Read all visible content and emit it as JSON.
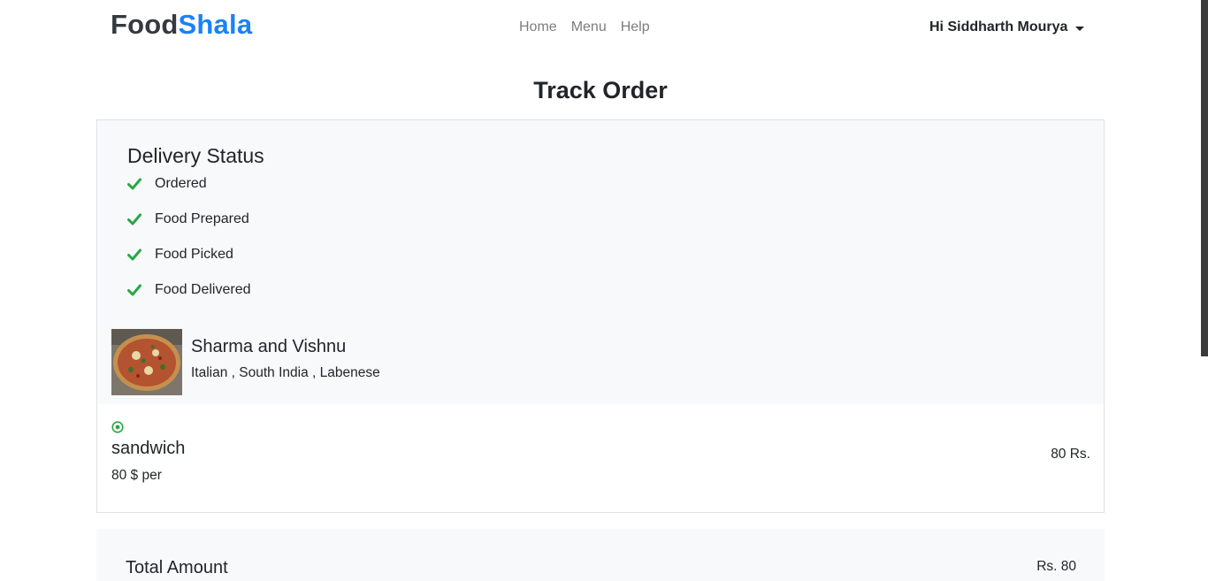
{
  "brand": {
    "part1": "Food",
    "part2": "Shala"
  },
  "nav": {
    "links": [
      "Home",
      "Menu",
      "Help"
    ]
  },
  "user": {
    "greeting": "Hi Siddharth Mourya"
  },
  "page": {
    "title": "Track Order"
  },
  "delivery": {
    "heading": "Delivery Status",
    "steps": [
      {
        "label": "Ordered",
        "done": true
      },
      {
        "label": "Food Prepared",
        "done": true
      },
      {
        "label": "Food Picked",
        "done": true
      },
      {
        "label": "Food Delivered",
        "done": true
      }
    ],
    "check_color": "#28a745"
  },
  "restaurant": {
    "name": "Sharma and Vishnu",
    "cuisines": "Italian , South India , Labenese",
    "image": "pizza-photo"
  },
  "order_items": [
    {
      "veg": true,
      "name": "sandwich",
      "unit_price": "80 $ per",
      "price": "80 Rs."
    }
  ],
  "total": {
    "label": "Total Amount",
    "value": "Rs. 80"
  },
  "colors": {
    "brand_dark": "#343a40",
    "brand_blue": "#1a82f7",
    "veg_green": "#28a745",
    "panel_bg": "#f8f9fa"
  }
}
